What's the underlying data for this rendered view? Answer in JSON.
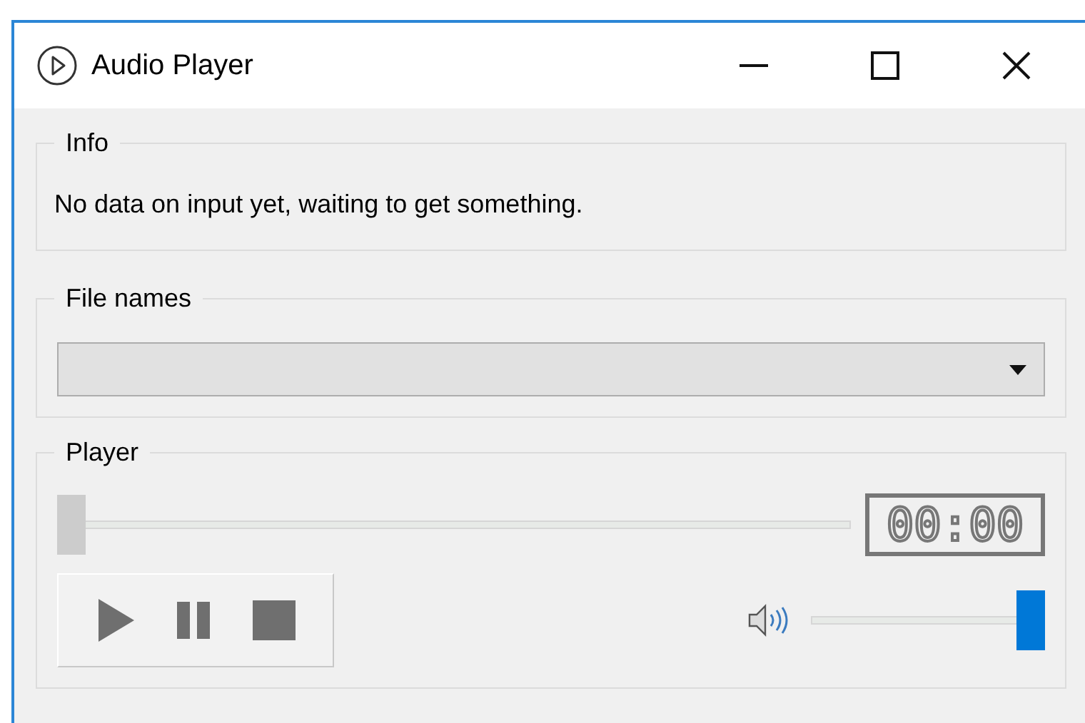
{
  "window": {
    "title": "Audio Player"
  },
  "info": {
    "title": "Info",
    "message": "No data on input yet, waiting to get something."
  },
  "file_names": {
    "title": "File names"
  },
  "player": {
    "title": "Player",
    "seek": {
      "level": 0,
      "disabled": true
    },
    "time": "00:00",
    "volume": {
      "level": 1,
      "disabled": false
    }
  }
}
